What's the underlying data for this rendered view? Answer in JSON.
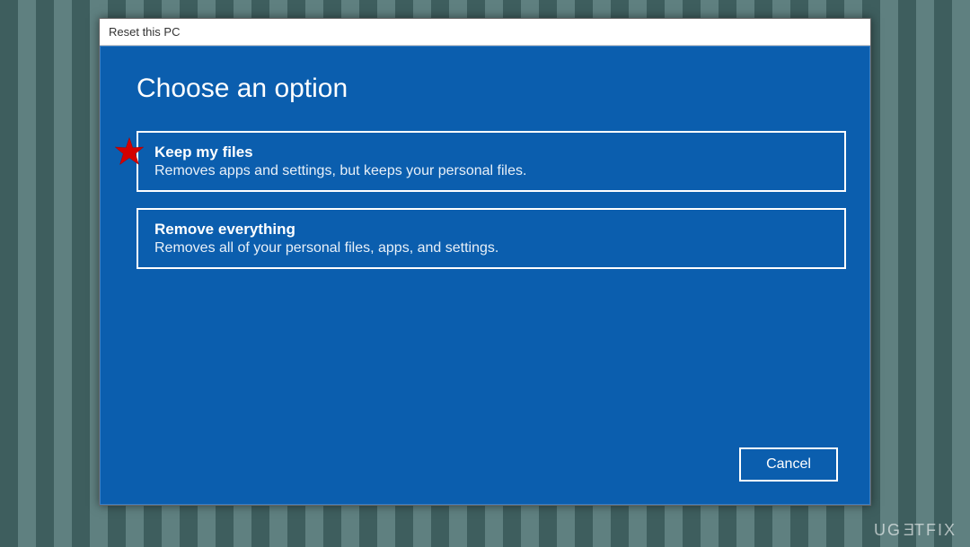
{
  "window": {
    "title": "Reset this PC"
  },
  "dialog": {
    "heading": "Choose an option",
    "options": [
      {
        "title": "Keep my files",
        "description": "Removes apps and settings, but keeps your personal files."
      },
      {
        "title": "Remove everything",
        "description": "Removes all of your personal files, apps, and settings."
      }
    ],
    "cancel_label": "Cancel"
  },
  "annotation": {
    "star_color": "#d40000"
  },
  "watermark": {
    "text": "UGETFIX"
  }
}
